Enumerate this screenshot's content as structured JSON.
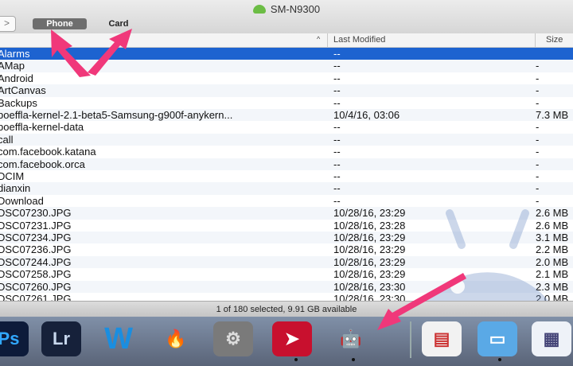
{
  "window": {
    "title": "SM-N9300",
    "icon": "android-transfer-icon"
  },
  "toolbar": {
    "back_glyph": ">",
    "tabs": [
      {
        "label": "Phone",
        "selected": true
      },
      {
        "label": "Card",
        "selected": false
      }
    ]
  },
  "columns": {
    "name_sort": "^",
    "modified": "Last Modified",
    "size": "Size"
  },
  "files": [
    {
      "name": "Alarms",
      "modified": "--",
      "size": ""
    },
    {
      "name": "AMap",
      "modified": "--",
      "size": "-"
    },
    {
      "name": "Android",
      "modified": "--",
      "size": "-"
    },
    {
      "name": "ArtCanvas",
      "modified": "--",
      "size": "-"
    },
    {
      "name": "Backups",
      "modified": "--",
      "size": "-"
    },
    {
      "name": "boeffla-kernel-2.1-beta5-Samsung-g900f-anykern...",
      "modified": "10/4/16, 03:06",
      "size": "7.3 MB"
    },
    {
      "name": "boeffla-kernel-data",
      "modified": "--",
      "size": "-"
    },
    {
      "name": "call",
      "modified": "--",
      "size": "-"
    },
    {
      "name": "com.facebook.katana",
      "modified": "--",
      "size": "-"
    },
    {
      "name": "com.facebook.orca",
      "modified": "--",
      "size": "-"
    },
    {
      "name": "DCIM",
      "modified": "--",
      "size": "-"
    },
    {
      "name": "dianxin",
      "modified": "--",
      "size": "-"
    },
    {
      "name": "Download",
      "modified": "--",
      "size": "-"
    },
    {
      "name": "DSC07230.JPG",
      "modified": "10/28/16, 23:29",
      "size": "2.6 MB"
    },
    {
      "name": "DSC07231.JPG",
      "modified": "10/28/16, 23:28",
      "size": "2.6 MB"
    },
    {
      "name": "DSC07234.JPG",
      "modified": "10/28/16, 23:29",
      "size": "3.1 MB"
    },
    {
      "name": "DSC07236.JPG",
      "modified": "10/28/16, 23:29",
      "size": "2.2 MB"
    },
    {
      "name": "DSC07244.JPG",
      "modified": "10/28/16, 23:29",
      "size": "2.0 MB"
    },
    {
      "name": "DSC07258.JPG",
      "modified": "10/28/16, 23:29",
      "size": "2.1 MB"
    },
    {
      "name": "DSC07260.JPG",
      "modified": "10/28/16, 23:30",
      "size": "2.3 MB"
    },
    {
      "name": "DSC07261.JPG",
      "modified": "10/28/16, 23:30",
      "size": "2.0 MB"
    }
  ],
  "status": {
    "text": "1 of 180 selected, 9.91 GB available"
  },
  "dock": [
    {
      "label": "Ps",
      "icon": "photoshop-icon",
      "bg": "#0d1b3a",
      "fg": "#31a8ff"
    },
    {
      "label": "Lr",
      "icon": "lightroom-icon",
      "bg": "#16213a",
      "fg": "#c8d8ee"
    },
    {
      "label": "W",
      "icon": "wunderlist-icon",
      "bg": "transparent",
      "fg": "#1a8ee0"
    },
    {
      "label": "",
      "icon": "flame-app-icon",
      "bg": "transparent",
      "fg": "#e04a1a"
    },
    {
      "label": "",
      "icon": "system-preferences-icon",
      "bg": "#7a7a7a",
      "fg": "#ddd"
    },
    {
      "label": "",
      "icon": "airmail-icon",
      "bg": "#c8102e",
      "fg": "#fff"
    },
    {
      "label": "",
      "icon": "android-file-transfer-icon",
      "bg": "transparent",
      "fg": "#7ac143"
    },
    {
      "label": "",
      "icon": "document-icon",
      "bg": "#f2f2f2",
      "fg": "#c33"
    },
    {
      "label": "",
      "icon": "folder-icon",
      "bg": "#5aa9e6",
      "fg": "#fff"
    },
    {
      "label": "",
      "icon": "spreadsheet-icon",
      "bg": "#eef2f8",
      "fg": "#447"
    }
  ],
  "colors": {
    "selection": "#1d63d0",
    "annotation_arrow": "#f0387a"
  }
}
